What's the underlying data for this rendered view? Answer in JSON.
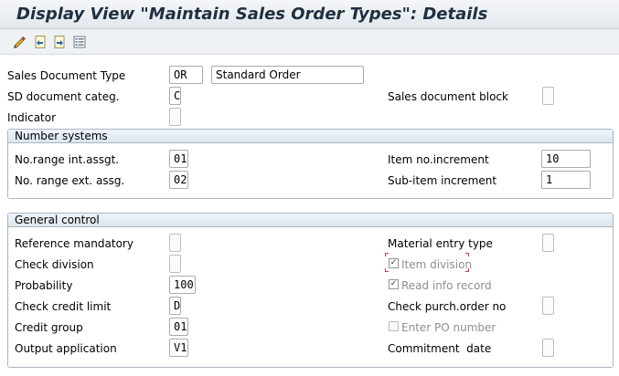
{
  "window": {
    "title": "Display View \"Maintain Sales Order Types\": Details"
  },
  "toolbar": {
    "icons": [
      "edit-pencil-icon",
      "previous-entry-icon",
      "next-entry-icon",
      "list-view-icon"
    ]
  },
  "header": {
    "sales_document_type_label": "Sales Document Type",
    "sales_document_type_value": "OR",
    "sales_document_type_desc": "Standard Order",
    "sd_document_categ_label": "SD document categ.",
    "sd_document_categ_value": "C",
    "sales_document_block_label": "Sales document block",
    "indicator_label": "Indicator"
  },
  "number_systems": {
    "title": "Number systems",
    "range_int_label": "No.range int.assgt.",
    "range_int_value": "01",
    "range_ext_label": "No. range ext. assg.",
    "range_ext_value": "02",
    "item_increment_label": "Item no.increment",
    "item_increment_value": "10",
    "subitem_increment_label": "Sub-item increment",
    "subitem_increment_value": "1"
  },
  "general_control": {
    "title": "General control",
    "reference_mandatory_label": "Reference mandatory",
    "check_division_label": "Check division",
    "probability_label": "Probability",
    "probability_value": "100",
    "check_credit_limit_label": "Check credit limit",
    "check_credit_limit_value": "D",
    "credit_group_label": "Credit group",
    "credit_group_value": "01",
    "output_application_label": "Output application",
    "output_application_value": "V1",
    "material_entry_type_label": "Material entry type",
    "item_division_label": "Item division",
    "item_division_checked": true,
    "read_info_record_label": "Read info record",
    "read_info_record_checked": true,
    "check_purch_order_label": "Check purch.order no",
    "enter_po_number_label": "Enter PO number",
    "enter_po_number_checked": false,
    "commitment_date_label": "Commitment  date"
  },
  "colors": {
    "title_text": "#1f2f3f",
    "focus_marker": "#d9363e"
  }
}
